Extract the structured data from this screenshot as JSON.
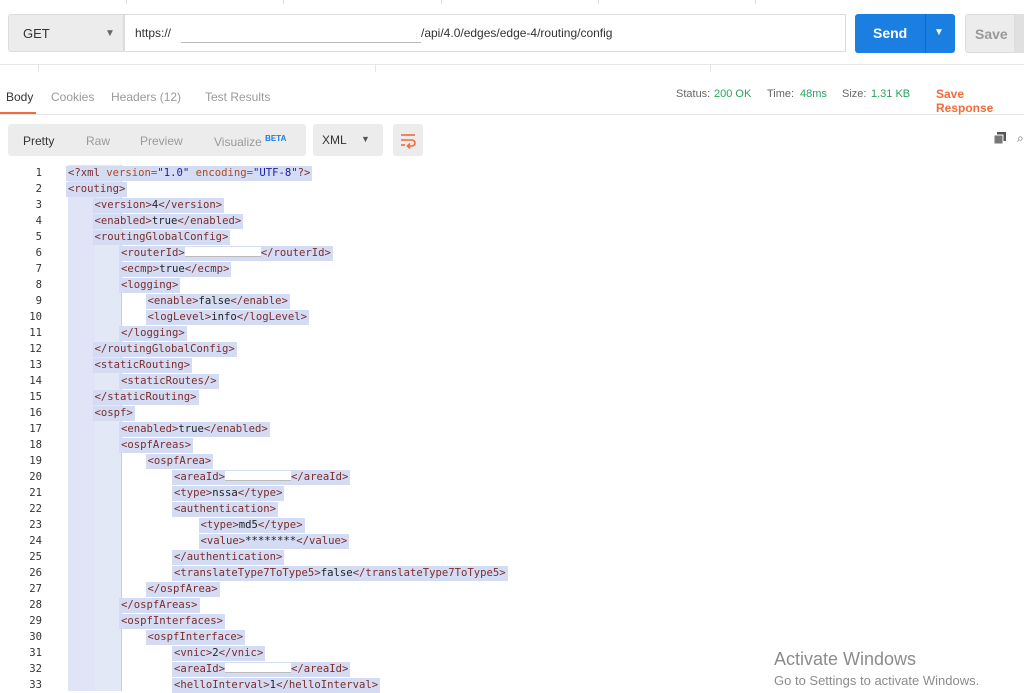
{
  "request": {
    "method": "GET",
    "url_prefix": "https://",
    "url_suffix": "/api/4.0/edges/edge-4/routing/config",
    "send_label": "Send",
    "save_label": "Save"
  },
  "tabs": [
    {
      "label": "Body",
      "active": true
    },
    {
      "label": "Cookies",
      "active": false
    },
    {
      "label": "Headers (12)",
      "active": false
    },
    {
      "label": "Test Results",
      "active": false
    }
  ],
  "status": {
    "status_label": "Status:",
    "status_value": "200 OK",
    "time_label": "Time:",
    "time_value": "48ms",
    "size_label": "Size:",
    "size_value": "1.31 KB",
    "save_response_label": "Save Response"
  },
  "view": {
    "modes": [
      "Pretty",
      "Raw",
      "Preview",
      "Visualize"
    ],
    "beta_label": "BETA",
    "format": "XML"
  },
  "colors": {
    "accent": "#f26b3a",
    "primary": "#1a7fe0",
    "ok": "#27a35c",
    "selection": "#d4dcf3"
  },
  "code_lines": [
    {
      "n": "1",
      "text": "<?xml version=\"1.0\" encoding=\"UTF-8\"?>"
    },
    {
      "n": "2",
      "text": "<routing>"
    },
    {
      "n": "3",
      "text": "<version>4</version>"
    },
    {
      "n": "4",
      "text": "<enabled>true</enabled>"
    },
    {
      "n": "5",
      "text": "<routingGlobalConfig>"
    },
    {
      "n": "6",
      "text": "<routerId></routerId>"
    },
    {
      "n": "7",
      "text": "<ecmp>true</ecmp>"
    },
    {
      "n": "8",
      "text": "<logging>"
    },
    {
      "n": "9",
      "text": "<enable>false</enable>"
    },
    {
      "n": "10",
      "text": "<logLevel>info</logLevel>"
    },
    {
      "n": "11",
      "text": "</logging>"
    },
    {
      "n": "12",
      "text": "</routingGlobalConfig>"
    },
    {
      "n": "13",
      "text": "<staticRouting>"
    },
    {
      "n": "14",
      "text": "<staticRoutes/>"
    },
    {
      "n": "15",
      "text": "</staticRouting>"
    },
    {
      "n": "16",
      "text": "<ospf>"
    },
    {
      "n": "17",
      "text": "<enabled>true</enabled>"
    },
    {
      "n": "18",
      "text": "<ospfAreas>"
    },
    {
      "n": "19",
      "text": "<ospfArea>"
    },
    {
      "n": "20",
      "text": "<areaId></areaId>"
    },
    {
      "n": "21",
      "text": "<type>nssa</type>"
    },
    {
      "n": "22",
      "text": "<authentication>"
    },
    {
      "n": "23",
      "text": "<type>md5</type>"
    },
    {
      "n": "24",
      "text": "<value>********</value>"
    },
    {
      "n": "25",
      "text": "</authentication>"
    },
    {
      "n": "26",
      "text": "<translateType7ToType5>false</translateType7ToType5>"
    },
    {
      "n": "27",
      "text": "</ospfArea>"
    },
    {
      "n": "28",
      "text": "</ospfAreas>"
    },
    {
      "n": "29",
      "text": "<ospfInterfaces>"
    },
    {
      "n": "30",
      "text": "<ospfInterface>"
    },
    {
      "n": "31",
      "text": "<vnic>2</vnic>"
    },
    {
      "n": "32",
      "text": "<areaId></areaId>"
    },
    {
      "n": "33",
      "text": "<helloInterval>1</helloInterval>"
    }
  ],
  "watermark": {
    "title": "Activate Windows",
    "subtitle": "Go to Settings to activate Windows."
  }
}
